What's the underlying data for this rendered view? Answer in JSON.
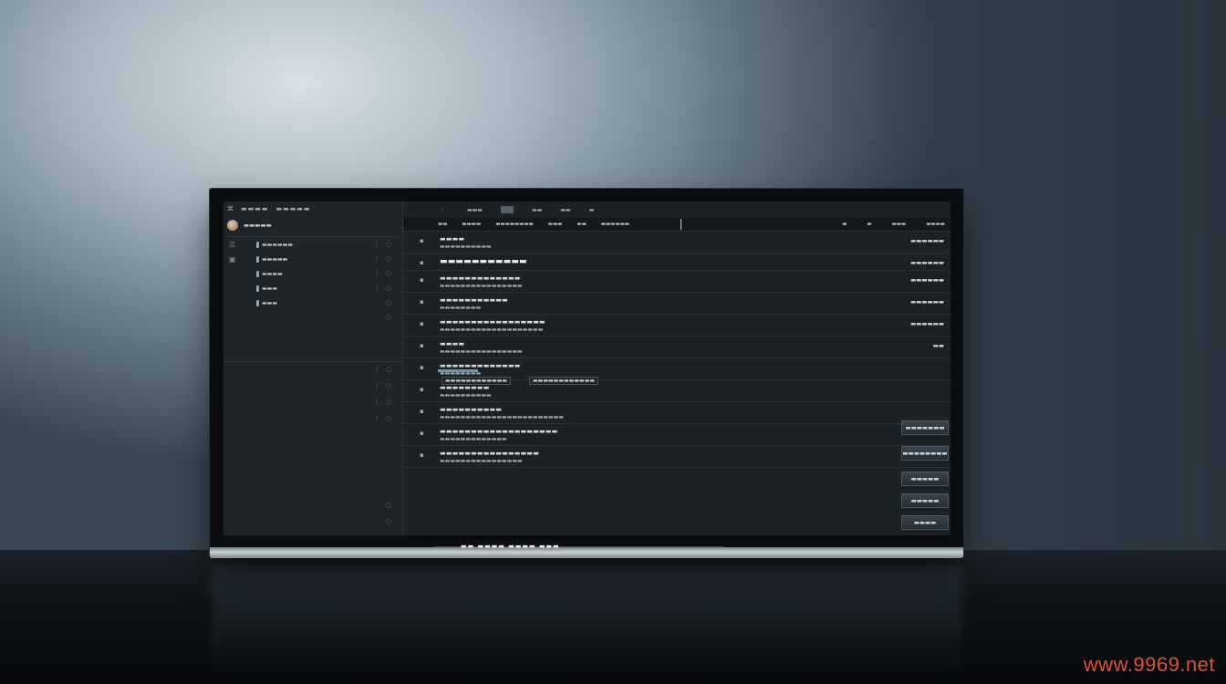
{
  "scene": {
    "watermark": "www.9969.net",
    "colors": {
      "wall": "#a7b6bf",
      "desk": "#0e1317",
      "screen_bg": "#1c2126",
      "accent": "#5f9db6",
      "watermark": "#e0522b"
    }
  },
  "app": {
    "left_pane": {
      "header": [
        "⌘",
        "▬▬▬▬",
        "▬▬▬▬▬"
      ],
      "search": "▬▬▬▬▬",
      "items": [
        {
          "label": "▬▬▬▬▬▬",
          "actions": "⋮ ◌"
        },
        {
          "label": "▬▬▬▬▬",
          "actions": "⋮ ◌"
        },
        {
          "label": "▬▬▬▬",
          "actions": "⋮ ◌"
        },
        {
          "label": "▬▬▬",
          "actions": "⋮ ◌"
        },
        {
          "label": "▬▬▬",
          "actions": "◌"
        },
        {
          "label": "",
          "actions": "◌"
        }
      ],
      "lower_actions": [
        "⋮ ◌",
        "⋮ ◌",
        "⋮ ◌",
        "⋮ ◌",
        "◌",
        "◌"
      ]
    },
    "toolbar": {
      "buttons": [
        "⋮",
        "▬▬▬",
        "▬▬",
        "▬▬",
        "▬"
      ]
    },
    "column_headers": {
      "left": [
        "▬▬",
        "▬▬▬▬",
        "▬▬▬▬▬▬▬▬",
        "▬▬▬",
        "▬▬",
        "▬▬▬▬▬▬"
      ],
      "right": [
        "▬",
        "▬",
        "▬▬▬",
        "▬▬▬▬"
      ]
    },
    "rows": [
      {
        "l1": "▬▬▬▬",
        "l2": "▬▬▬▬▬▬▬▬▬▬",
        "tag": "▬▬▬▬▬▬"
      },
      {
        "l1": "▬▬▬▬▬▬▬▬▬▬▬",
        "l2": "",
        "tag": "▬▬▬▬▬▬",
        "big": true
      },
      {
        "l1": "▬▬▬▬▬▬▬▬▬▬▬▬▬",
        "l2": "▬▬▬▬▬▬▬▬▬▬▬▬▬▬▬▬",
        "tag": "▬▬▬▬▬▬"
      },
      {
        "l1": "▬▬▬▬▬▬▬▬▬▬▬",
        "l2": "▬▬▬▬▬▬▬▬",
        "tag": "▬▬▬▬▬▬"
      },
      {
        "l1": "▬▬▬▬▬▬▬▬▬▬▬▬▬▬▬▬▬",
        "l2": "▬▬▬▬▬▬▬▬▬▬▬▬▬▬▬▬▬▬▬▬",
        "tag": "▬▬▬▬▬▬"
      },
      {
        "l1": "▬▬▬▬",
        "l2": "▬▬▬▬▬▬▬▬▬▬▬▬▬▬▬▬",
        "tag": "▬▬"
      },
      {
        "l1": "▬▬▬▬▬▬▬▬▬▬▬▬▬",
        "l2": "▬▬▬▬▬▬▬▬",
        "tag": ""
      },
      {
        "l1": "▬▬▬▬▬▬▬▬",
        "l2": "▬▬▬▬▬▬▬▬▬▬",
        "tag": ""
      },
      {
        "l1": "▬▬▬▬▬▬▬▬▬▬",
        "l2": "▬▬▬▬▬▬▬▬▬▬▬▬▬▬▬▬▬▬▬▬▬▬▬▬",
        "tag": ""
      },
      {
        "l1": "▬▬▬▬▬▬▬▬▬▬▬▬▬▬▬▬▬▬▬",
        "l2": "▬▬▬▬▬▬▬▬▬▬▬▬▬",
        "tag": ""
      },
      {
        "l1": "▬▬▬▬▬▬▬▬▬▬▬▬▬▬▬▬",
        "l2": "▬▬▬▬▬▬▬▬▬▬▬▬▬▬▬▬",
        "tag": ""
      }
    ],
    "chip_text": "▬▬▬▬▬▬▬▬▬▬▬▬",
    "chip_text_2": "▬▬▬▬▬▬▬▬▬▬▬▬",
    "side_buttons": [
      "▬▬▬▬▬▬▬",
      "▬▬▬▬▬▬▬▬",
      "▬▬▬▬▬",
      "▬▬▬▬▬",
      "▬▬▬▬"
    ],
    "stand_label": "▬▬ ▬▬▬▬ ▬▬▬▬ ▬▬▬"
  }
}
